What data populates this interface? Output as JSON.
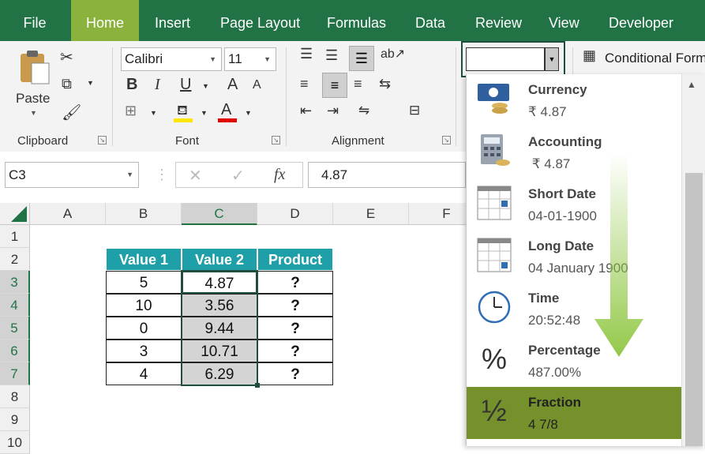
{
  "menu": {
    "tabs": [
      "File",
      "Home",
      "Insert",
      "Page Layout",
      "Formulas",
      "Data",
      "Review",
      "View",
      "Developer"
    ],
    "active": "Home"
  },
  "ribbon": {
    "clipboard": {
      "paste_label": "Paste",
      "group_label": "Clipboard"
    },
    "font": {
      "name": "Calibri",
      "size": "11",
      "group_label": "Font",
      "bold": "B",
      "italic": "I",
      "underline": "U",
      "grow": "A",
      "shrink": "A",
      "font_color_letter": "A"
    },
    "alignment": {
      "group_label": "Alignment"
    },
    "number_format": {
      "value": ""
    },
    "conditional_formatting": "Conditional Form"
  },
  "formula_bar": {
    "name_box": "C3",
    "fx": "fx",
    "value": "4.87"
  },
  "sheet": {
    "columns": [
      "A",
      "B",
      "C",
      "D",
      "E",
      "F"
    ],
    "rows": [
      "1",
      "2",
      "3",
      "4",
      "5",
      "6",
      "7",
      "8",
      "9",
      "10"
    ],
    "table": {
      "headers": [
        "Value 1",
        "Value 2",
        "Product"
      ],
      "rows": [
        [
          "5",
          "4.87",
          "?"
        ],
        [
          "10",
          "3.56",
          "?"
        ],
        [
          "0",
          "9.44",
          "?"
        ],
        [
          "3",
          "10.71",
          "?"
        ],
        [
          "4",
          "6.29",
          "?"
        ]
      ]
    }
  },
  "number_format_dropdown": {
    "items": [
      {
        "name": "Currency",
        "example": "₹ 4.87",
        "icon": "currency-icon"
      },
      {
        "name": "Accounting",
        "example": " ₹ 4.87",
        "icon": "accounting-icon"
      },
      {
        "name": "Short Date",
        "example": "04-01-1900",
        "icon": "calendar-icon"
      },
      {
        "name": "Long Date",
        "example": "04 January 1900",
        "icon": "calendar-icon"
      },
      {
        "name": "Time",
        "example": "20:52:48",
        "icon": "clock-icon"
      },
      {
        "name": "Percentage",
        "example": "487.00%",
        "icon": "percent-icon"
      },
      {
        "name": "Fraction",
        "example": "4 7/8",
        "icon": "fraction-icon"
      }
    ],
    "selected": "Fraction"
  },
  "colors": {
    "excel_green": "#217346",
    "active_tab": "#8cb23e",
    "header_teal": "#1fa0a8",
    "selection_olive": "#75912c",
    "arrow_green": "#8dc63f"
  }
}
